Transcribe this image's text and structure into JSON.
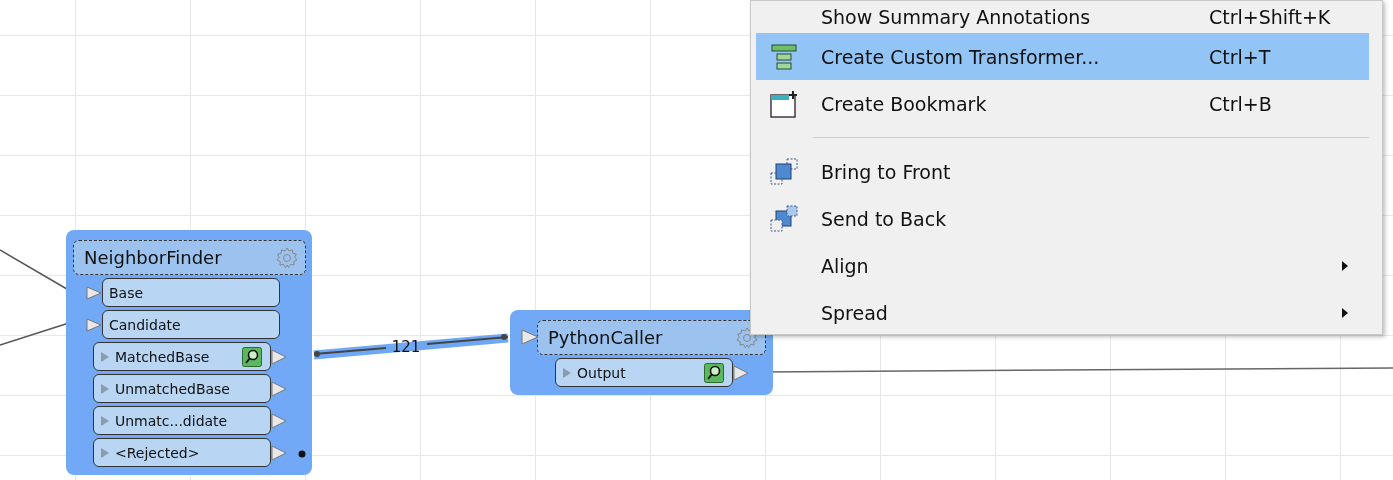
{
  "canvas": {
    "nodes": [
      {
        "title": "NeighborFinder",
        "selected": true,
        "inputs": [
          "Base",
          "Candidate"
        ],
        "outputs": [
          {
            "label": "MatchedBase",
            "inspect": true
          },
          {
            "label": "UnmatchedBase",
            "inspect": false
          },
          {
            "label": "Unmatc...didate",
            "inspect": false
          },
          {
            "label": "<Rejected>",
            "inspect": false
          }
        ]
      },
      {
        "title": "PythonCaller",
        "selected": true,
        "outputs": [
          {
            "label": "Output",
            "inspect": true
          }
        ]
      }
    ],
    "connections": [
      {
        "label": "121",
        "selected": true
      }
    ]
  },
  "context_menu": {
    "items": [
      {
        "kind": "item",
        "label": "Show Summary Annotations",
        "shortcut": "Ctrl+Shift+K",
        "selected": false,
        "submenu": false
      },
      {
        "kind": "item",
        "label": "Create Custom Transformer...",
        "shortcut": "Ctrl+T",
        "selected": true,
        "submenu": false
      },
      {
        "kind": "item",
        "label": "Create Bookmark",
        "shortcut": "Ctrl+B",
        "selected": false,
        "submenu": false
      },
      {
        "kind": "separator"
      },
      {
        "kind": "item",
        "label": "Bring to Front",
        "selected": false,
        "submenu": false
      },
      {
        "kind": "item",
        "label": "Send to Back",
        "selected": false,
        "submenu": false
      },
      {
        "kind": "item",
        "label": "Align",
        "selected": false,
        "submenu": true
      },
      {
        "kind": "item",
        "label": "Spread",
        "selected": false,
        "submenu": true
      }
    ]
  }
}
